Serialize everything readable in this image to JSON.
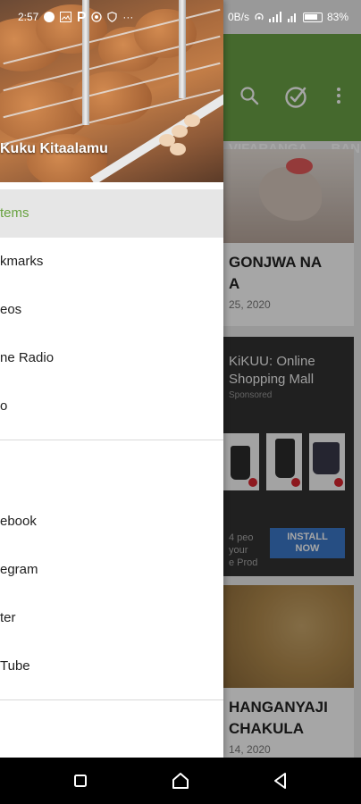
{
  "status_bar": {
    "time": "2:57",
    "speed": "0B/s",
    "battery": "83%"
  },
  "app": {
    "tabs": [
      "VIFARANGA",
      "BAN"
    ],
    "articles": [
      {
        "title_line1": "GONJWA NA",
        "title_line2": "A",
        "date": "25, 2020"
      },
      {
        "title_line1": "HANGANYAJI",
        "title_line2": "CHAKULA",
        "date": "14, 2020"
      }
    ],
    "ad": {
      "title": "KiKUU: Online Shopping Mall",
      "sponsored": "Sponsored",
      "small_line1": "4 peo",
      "small_line2": "your",
      "small_line3": "e Prod",
      "install_line1": "INSTALL",
      "install_line2": "NOW"
    }
  },
  "drawer": {
    "title": "Kuku Kitaalamu",
    "items": [
      {
        "label": "tems",
        "active": true
      },
      {
        "label": "kmarks"
      },
      {
        "label": "eos"
      },
      {
        "label": "ne Radio"
      },
      {
        "label": "o"
      }
    ],
    "social": [
      {
        "label": "ebook"
      },
      {
        "label": "egram"
      },
      {
        "label": "ter"
      },
      {
        "label": "Tube"
      }
    ]
  },
  "colors": {
    "accent_green": "#6aa245",
    "ad_install_blue": "#3b78c9"
  }
}
